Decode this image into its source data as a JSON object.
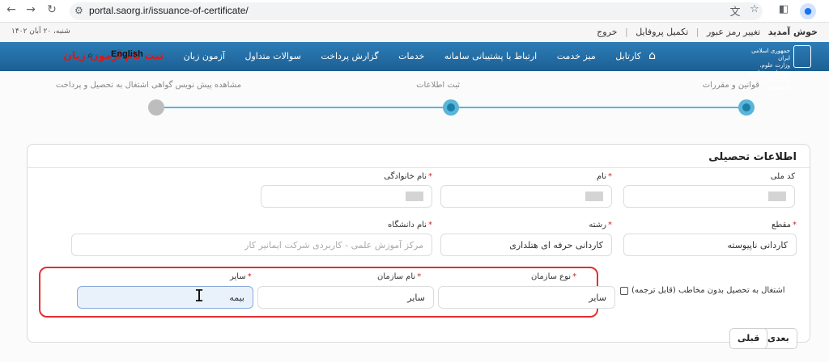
{
  "browser": {
    "url": "portal.saorg.ir/issuance-of-certificate/",
    "icons": [
      "back-icon",
      "forward-icon",
      "reload-icon",
      "tune-icon",
      "translate-icon",
      "star-icon",
      "sidebar-icon",
      "profile-icon"
    ]
  },
  "topbar": {
    "links": [
      "خوش آمدید",
      "تغییر رمز عبور",
      "تکمیل پروفایل",
      "خروج"
    ],
    "date": "شنبه، ۲۰ آبان ۱۴۰۲"
  },
  "navbar": {
    "logo_lines": [
      "جمهوری اسلامی ایران",
      "وزارت علوم، تحقیقات و فناوری",
      "سازمان امور دانشجویان"
    ],
    "menu": [
      "کارتابل",
      "میز خدمت",
      "ارتباط با پشتیبانی سامانه",
      "خدمات",
      "گزارش پرداخت",
      "سوالات متداول",
      "آزمون زبان"
    ],
    "register_exam": "ثبت نام آزمون زبان",
    "english": "English"
  },
  "steps": [
    {
      "label": "قوانین و مقررات",
      "state": "active"
    },
    {
      "label": "ثبت اطلاعات",
      "state": "active"
    },
    {
      "label": "مشاهده پیش نویس گواهی اشتغال به تحصیل و پرداخت",
      "state": "idle"
    }
  ],
  "colors": {
    "accent": "#1c7fa8",
    "progress": "#5ab5d8",
    "highlight": "#e23030",
    "required": "#c62828",
    "navbar": "#2d7db8"
  },
  "form": {
    "title": "اطلاعات تحصیلی",
    "required_mark": "*",
    "national_code": {
      "label": "کد ملی"
    },
    "first_name": {
      "label": "نام"
    },
    "last_name": {
      "label": "نام خانوادگی"
    },
    "grade": {
      "label": "مقطع",
      "value": "کاردانی ناپیوسته"
    },
    "major": {
      "label": "رشته",
      "value": "کاردانی حرفه ای هتلداری"
    },
    "university": {
      "label": "نام دانشگاه",
      "placeholder": "مرکز آموزش علمی - کاربردی شرکت ایمانیر کار"
    },
    "employment_checkbox": {
      "label": "اشتغال به تحصیل بدون مخاطب (قابل ترجمه)"
    },
    "org_type": {
      "label": "نوع سازمان",
      "value": "سایر"
    },
    "org_name": {
      "label": "نام سازمان",
      "value": "سایر"
    },
    "other": {
      "label": "سایر",
      "value": "بیمه"
    }
  },
  "buttons": {
    "next": "بعدی",
    "prev": "قبلی"
  }
}
